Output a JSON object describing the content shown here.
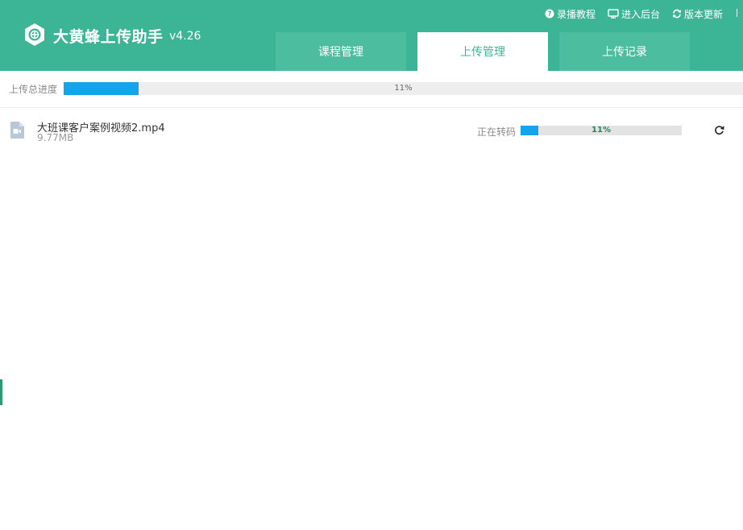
{
  "app": {
    "title": "大黄蜂上传助手",
    "version": "v4.26",
    "brand_color": "#3cb597"
  },
  "top_links": [
    {
      "icon": "question-circle-icon",
      "label": "录播教程"
    },
    {
      "icon": "monitor-icon",
      "label": "进入后台"
    },
    {
      "icon": "refresh-icon",
      "label": "版本更新"
    }
  ],
  "tabs": [
    {
      "label": "课程管理",
      "active": false
    },
    {
      "label": "上传管理",
      "active": true
    },
    {
      "label": "上传记录",
      "active": false
    }
  ],
  "total_progress": {
    "label": "上传总进度",
    "percent": 11,
    "percent_text": "11%",
    "bar_color": "#13a4ec"
  },
  "files": [
    {
      "icon": "video-file-icon",
      "name": "大班课客户案例视频2.mp4",
      "size": "9.77MB",
      "status": "正在转码",
      "percent": 11,
      "percent_text": "11%",
      "action_icon": "retry-icon"
    }
  ]
}
